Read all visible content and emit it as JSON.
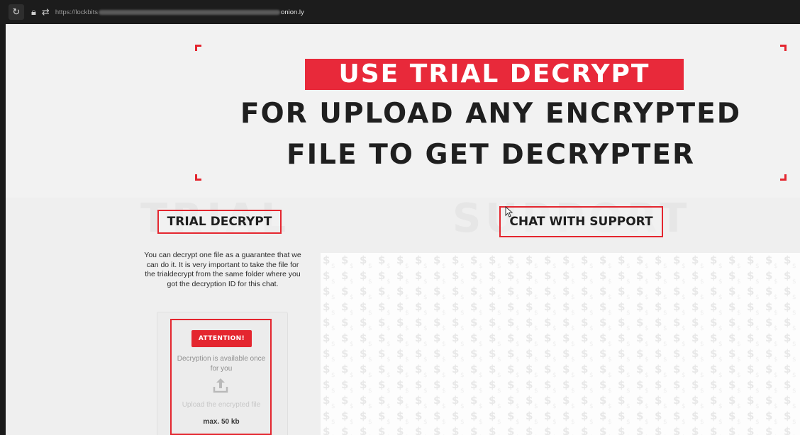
{
  "browser": {
    "reload_icon": "reload-icon",
    "lock_icon": "lock-icon",
    "swap_icon": "swap-icon",
    "url_prefix": "https://lockbits",
    "url_suffix": "onion.ly"
  },
  "hero": {
    "highlight": "USE TRIAL DECRYPT",
    "line2": "FOR UPLOAD ANY ENCRYPTED",
    "line3": "FILE TO GET DECRYPTER"
  },
  "trial": {
    "bg_word": "TRIAL",
    "title": "TRIAL DECRYPT",
    "description": "You can decrypt one file as a guarantee that we can do it. It is very important to take the file for the trialdecrypt from the same folder where you got the decryption ID for this chat.",
    "attention_button": "ATTENTION!",
    "availability": "Decryption is available once for you",
    "upload_label": "Upload the encrypted file",
    "max_size": "max. 50 kb"
  },
  "chat": {
    "bg_word": "SUPPORT",
    "title": "CHAT WITH SUPPORT"
  },
  "colors": {
    "accent": "#e4262f",
    "highlight_bg": "#e8293a",
    "page_bg": "#f1f1f1",
    "topbar_bg": "#1c1c1c"
  }
}
